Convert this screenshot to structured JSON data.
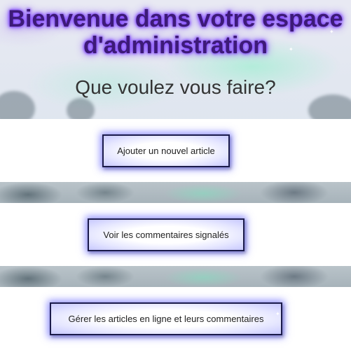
{
  "header": {
    "title": "Bienvenue dans votre espace d'administration",
    "subtitle": "Que voulez vous faire?"
  },
  "actions": [
    {
      "label": "Ajouter un nouvel article"
    },
    {
      "label": "Voir les commentaires signalés"
    },
    {
      "label": "Gérer les articles en ligne et leurs commentaires"
    }
  ],
  "colors": {
    "title_text": "#3d1a78",
    "title_glow": "#7a3cff",
    "subtitle_text": "#333333",
    "button_glow": "#6e6eff",
    "panel_background": "#ffffff"
  }
}
